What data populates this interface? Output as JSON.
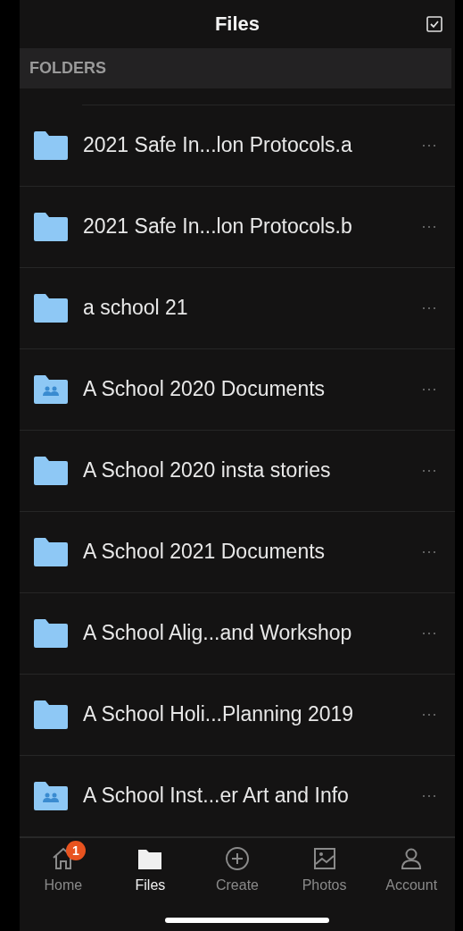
{
  "header": {
    "title": "Files"
  },
  "section": {
    "title": "FOLDERS"
  },
  "folders": [
    {
      "name": "2021 Safe In...lon Protocols.a",
      "kind": "folder",
      "menu": "···"
    },
    {
      "name": "2021 Safe In...lon Protocols.b",
      "kind": "folder",
      "menu": "···"
    },
    {
      "name": "a school 21",
      "kind": "folder",
      "menu": "···"
    },
    {
      "name": "A School 2020 Documents",
      "kind": "shared",
      "menu": "···"
    },
    {
      "name": "A School 2020 insta stories",
      "kind": "folder",
      "menu": "···"
    },
    {
      "name": "A School 2021 Documents",
      "kind": "folder",
      "menu": "···"
    },
    {
      "name": "A School Alig...and Workshop",
      "kind": "folder",
      "menu": "···"
    },
    {
      "name": "A School Holi...Planning 2019",
      "kind": "folder",
      "menu": "···"
    },
    {
      "name": "A School Inst...er Art and Info",
      "kind": "shared",
      "menu": "···"
    }
  ],
  "tabs": [
    {
      "label": "Home",
      "kind": "home",
      "selected": false,
      "badge": "1"
    },
    {
      "label": "Files",
      "kind": "files",
      "selected": true
    },
    {
      "label": "Create",
      "kind": "create",
      "selected": false
    },
    {
      "label": "Photos",
      "kind": "photos",
      "selected": false
    },
    {
      "label": "Account",
      "kind": "account",
      "selected": false
    }
  ]
}
